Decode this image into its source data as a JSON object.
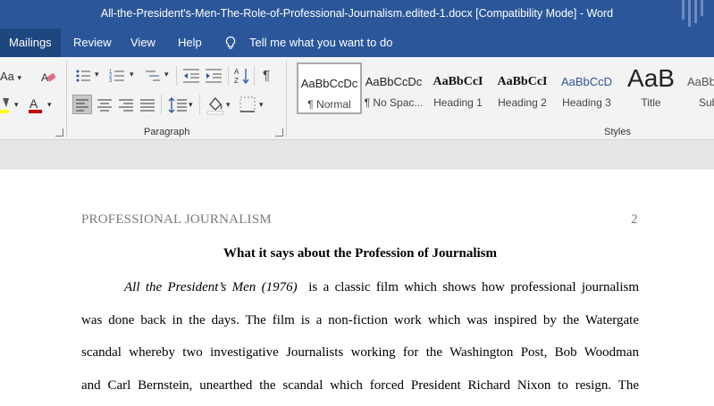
{
  "window": {
    "title": "All-the-President's-Men-The-Role-of-Professional-Journalism.edited-1.docx [Compatibility Mode]  -  Word"
  },
  "tabs": [
    {
      "label": "Mailings"
    },
    {
      "label": "Review"
    },
    {
      "label": "View"
    },
    {
      "label": "Help"
    }
  ],
  "tell_me": {
    "label": "Tell me what you want to do"
  },
  "ribbon": {
    "font_group": {
      "case_label": "Aa"
    },
    "paragraph_group": {
      "label": "Paragraph"
    },
    "styles_group": {
      "label": "Styles"
    }
  },
  "styles": [
    {
      "sample": "AaBbCcDc",
      "name": "¶ Normal"
    },
    {
      "sample": "AaBbCcDc",
      "name": "¶ No Spac..."
    },
    {
      "sample": "AaBbCcI",
      "name": "Heading 1"
    },
    {
      "sample": "AaBbCcI",
      "name": "Heading 2"
    },
    {
      "sample": "AaBbCcD",
      "name": "Heading 3"
    },
    {
      "sample": "AaB",
      "name": "Title"
    },
    {
      "sample": "AaBbC",
      "name": "Subt"
    }
  ],
  "colors": {
    "word_blue": "#2b579a",
    "heading3_blue": "#2f5496",
    "highlight": "#ffff00",
    "font_color": "#c00000"
  },
  "document": {
    "running_head": "PROFESSIONAL JOURNALISM",
    "page_number": "2",
    "heading": "What it says about the Profession of Journalism",
    "para1_italic": "All the President’s Men (1976)",
    "para1_line1_rest": " is a classic film which shows how professional journalism",
    "para1_line2": "was done back in the days. The film is a non-fiction work which was inspired by the Watergate",
    "para1_line3": "scandal whereby two investigative Journalists working for the Washington Post, Bob Woodman",
    "para1_line4": "and Carl Bernstein, unearthed the scandal which forced President Richard Nixon to resign. The"
  }
}
